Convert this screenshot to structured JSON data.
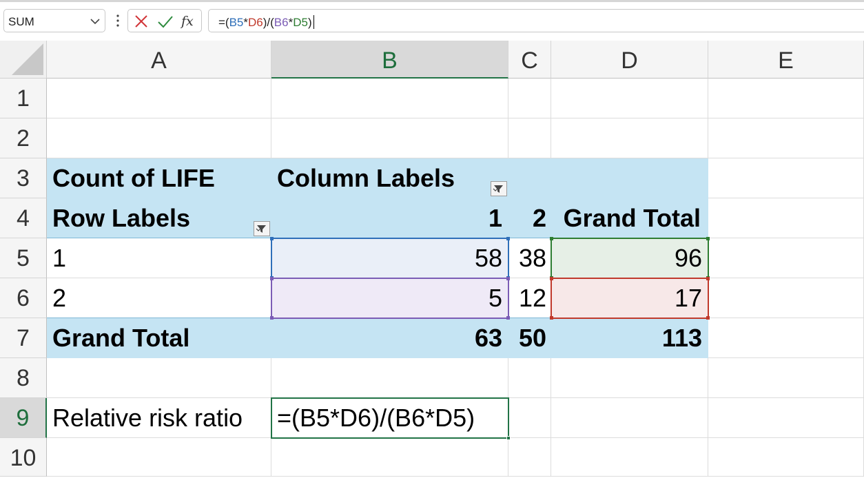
{
  "formula_bar": {
    "name_box": "SUM",
    "formula_parts": [
      "=(",
      "B5",
      "*",
      "D6",
      ")/(",
      "B6",
      "*",
      "D5",
      ")"
    ],
    "cancel_icon": "x-icon",
    "enter_icon": "check-icon",
    "function_icon": "fx-icon"
  },
  "columns": [
    {
      "label": "A"
    },
    {
      "label": "B"
    },
    {
      "label": "C"
    },
    {
      "label": "D"
    },
    {
      "label": "E"
    }
  ],
  "rows": [
    "1",
    "2",
    "3",
    "4",
    "5",
    "6",
    "7",
    "8",
    "9",
    "10"
  ],
  "cells": {
    "a3": "Count of LIFE",
    "b3": "Column Labels",
    "a4": "Row Labels",
    "b4": "1",
    "c4": "2",
    "d4": "Grand Total",
    "a5": "1",
    "b5": "58",
    "c5": "38",
    "d5": "96",
    "a6": "2",
    "b6": "5",
    "c6": "12",
    "d6": "17",
    "a7": "Grand Total",
    "b7": "63",
    "c7": "50",
    "d7": "113",
    "a9": "Relative risk ratio",
    "b9": "=(B5*D6)/(B6*D5)"
  },
  "colors": {
    "pivot_fill": "#c5e4f3",
    "selection_green": "#217346",
    "ref_b5": "#2f6fb9",
    "ref_d6": "#c0392b",
    "ref_b6": "#7b5cb5",
    "ref_d5": "#2e7d32"
  }
}
